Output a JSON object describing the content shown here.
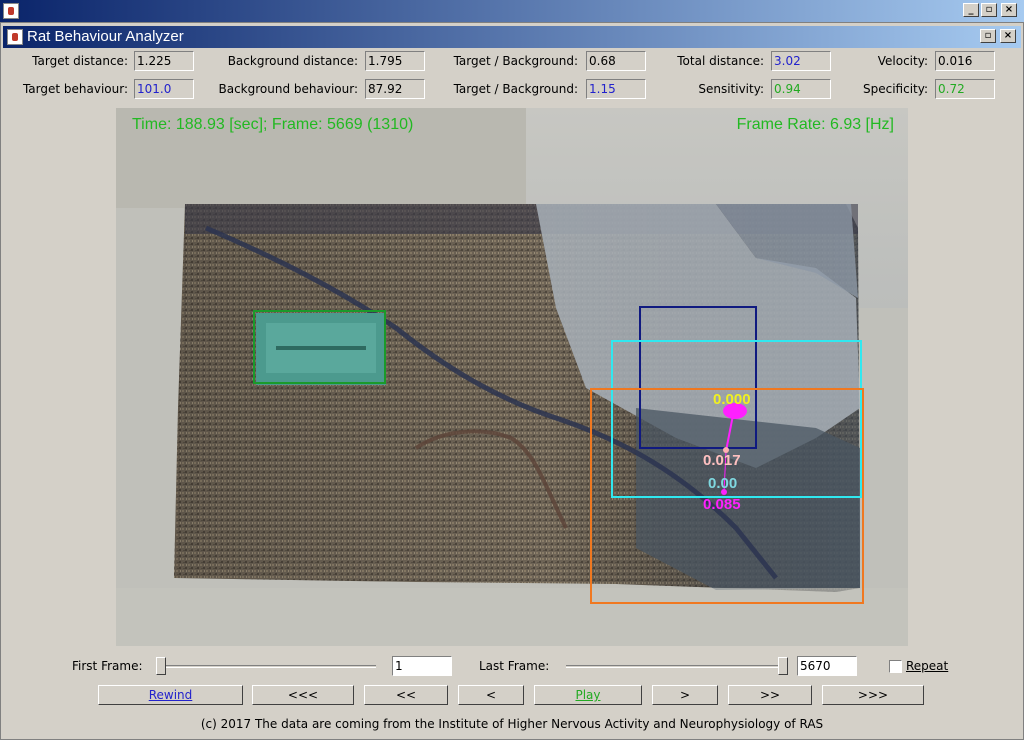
{
  "window": {
    "title": "Rat Behaviour Analyzer",
    "minimize_glyph": "_",
    "restore_glyph": "▫",
    "close_glyph": "×"
  },
  "stats": {
    "row1": [
      {
        "label": "Target distance:",
        "value": "1.225",
        "color": "#000000"
      },
      {
        "label": "Background distance:",
        "value": "1.795",
        "color": "#000000"
      },
      {
        "label": "Target / Background:",
        "value": "0.68",
        "color": "#000000"
      },
      {
        "label": "Total distance:",
        "value": "3.02",
        "color": "#2222cc"
      },
      {
        "label": "Velocity:",
        "value": "0.016",
        "color": "#000000"
      }
    ],
    "row2": [
      {
        "label": "Target behaviour:",
        "value": "101.0",
        "color": "#2222cc"
      },
      {
        "label": "Background behaviour:",
        "value": "87.92",
        "color": "#000000"
      },
      {
        "label": "Target / Background:",
        "value": "1.15",
        "color": "#2222cc"
      },
      {
        "label": "Sensitivity:",
        "value": "0.94",
        "color": "#22aa22"
      },
      {
        "label": "Specificity:",
        "value": "0.72",
        "color": "#22aa22"
      }
    ]
  },
  "video": {
    "time_text": "Time: 188.93 [sec]; Frame: 5669 (1310)",
    "frame_rate_text": "Frame Rate: 6.93 [Hz]",
    "labels": {
      "yellow": "0.000",
      "pink": "0.017",
      "cyan": "0.00",
      "magenta": "0.085"
    },
    "box_colors": {
      "green": "#1a9a2a",
      "navy": "#101a80",
      "cyan": "#30e8f0",
      "orange": "#f07820",
      "magenta": "#ff20ff"
    }
  },
  "controls": {
    "first_frame_label": "First Frame:",
    "first_frame_value": "1",
    "last_frame_label": "Last Frame:",
    "last_frame_value": "5670",
    "first_slider_fraction": 0.0,
    "last_slider_fraction": 1.0,
    "repeat_label": "Repeat",
    "repeat_checked": false,
    "buttons": {
      "rewind": "Rewind",
      "back3": "<<<",
      "back2": "<<",
      "back1": "<",
      "play": "Play",
      "fwd1": ">",
      "fwd2": ">>",
      "fwd3": ">>>"
    }
  },
  "footer": {
    "text": "(c) 2017 The data are coming from the Institute of Higher Nervous Activity and Neurophysiology of RAS"
  }
}
